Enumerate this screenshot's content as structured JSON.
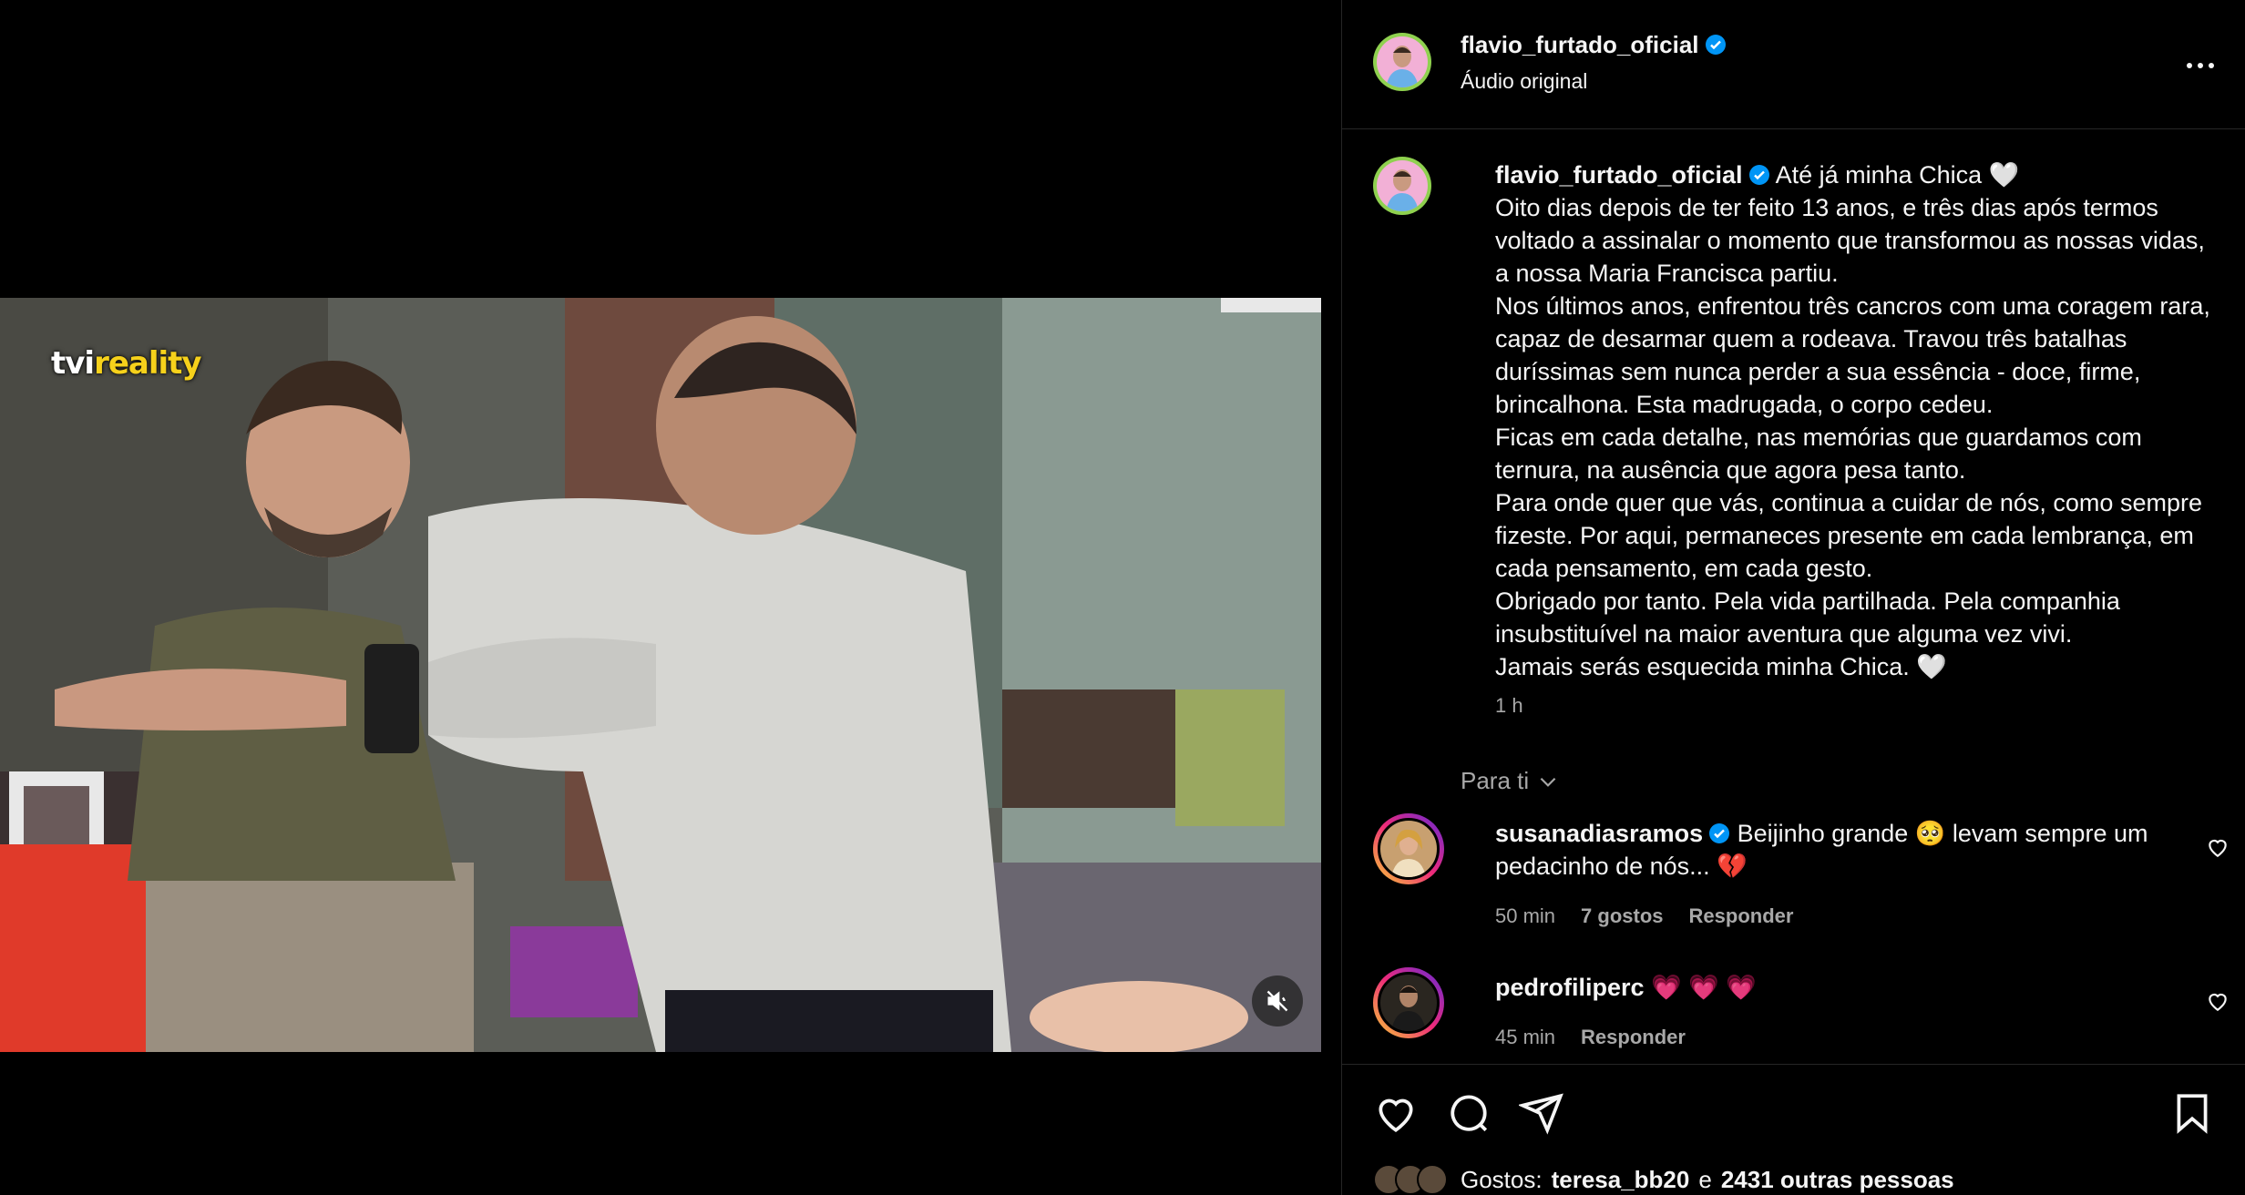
{
  "post": {
    "username": "flavio_furtado_oficial",
    "audio": "Áudio original",
    "video_logo": {
      "part1": "tvi",
      "part2": "reality"
    }
  },
  "caption": {
    "username": "flavio_furtado_oficial",
    "lines": [
      "Até já minha Chica 🤍",
      "Oito dias depois de ter feito 13 anos, e três dias após termos",
      "voltado a assinalar o momento que transformou as nossas vidas,",
      "a nossa Maria Francisca partiu.",
      "Nos últimos anos, enfrentou três cancros com uma coragem rara,",
      "capaz de desarmar quem a rodeava. Travou três batalhas",
      "duríssimas sem nunca perder a sua essência - doce, firme,",
      "brincalhona. Esta madrugada, o corpo cedeu.",
      "Ficas em cada detalhe, nas memórias que guardamos com",
      "ternura, na ausência que agora pesa tanto.",
      "Para onde quer que vás, continua a cuidar de nós, como sempre",
      "fizeste. Por aqui, permaneces presente em cada lembrança, em",
      "cada pensamento, em cada gesto.",
      "Obrigado por tanto. Pela vida partilhada. Pela companhia",
      "insubstituível na maior aventura que alguma vez vivi.",
      "Jamais serás esquecida minha Chica. 🤍"
    ],
    "time": "1 h"
  },
  "filter": {
    "label": "Para ti"
  },
  "comments": [
    {
      "username": "susanadiasramos",
      "verified": true,
      "line1": "Beijinho grande 🥺 levam sempre um",
      "line2": "pedacinho de nós... 💔",
      "time": "50 min",
      "likes": "7 gostos",
      "reply": "Responder"
    },
    {
      "username": "pedrofiliperc",
      "verified": false,
      "line1": "💗 💗 💗",
      "time": "45 min",
      "reply": "Responder"
    }
  ],
  "likes": {
    "prefix": "Gostos:",
    "user": "teresa_bb20",
    "joiner": "e",
    "others": "2431 outras pessoas"
  },
  "icons": [
    "more-icon",
    "verified-icon",
    "mute-icon",
    "heart-icon",
    "comment-icon",
    "share-icon",
    "bookmark-icon",
    "chevron-down-icon"
  ],
  "colors": {
    "background": "#000000",
    "text": "#f5f5f5",
    "muted": "#a8a8a8",
    "verified": "#0095f6",
    "divider": "#262626"
  }
}
